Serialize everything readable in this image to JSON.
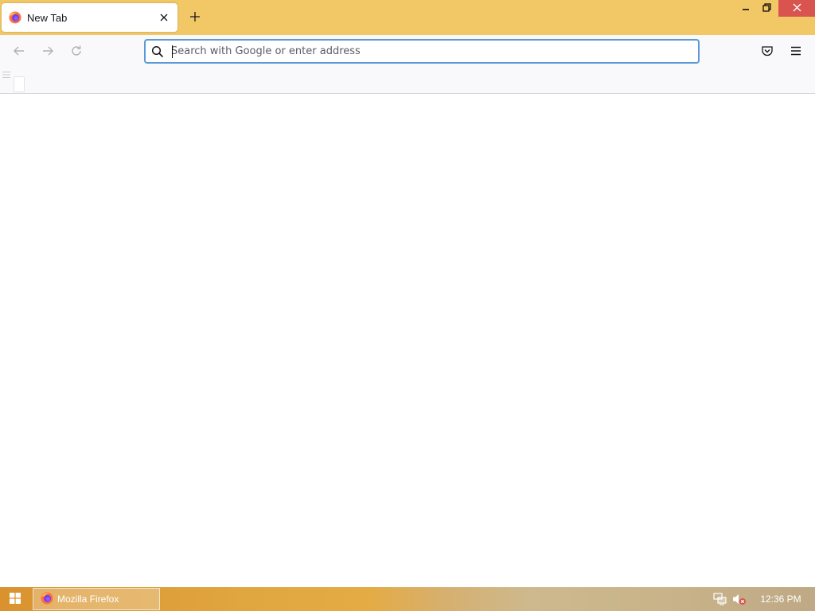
{
  "tabs": [
    {
      "title": "New Tab",
      "favicon": "firefox-icon",
      "close_icon": "close-icon"
    }
  ],
  "new_tab_icon": "plus-icon",
  "window_controls": [
    "minimize-icon",
    "restore-icon",
    "close-icon"
  ],
  "nav": {
    "back_icon": "back-arrow-icon",
    "forward_icon": "forward-arrow-icon",
    "reload_icon": "reload-icon",
    "pocket_icon": "pocket-icon",
    "menu_icon": "hamburger-menu-icon"
  },
  "urlbar": {
    "placeholder": "Search with Google or enter address",
    "value": "",
    "icon": "search-icon",
    "focus_color": "#5b9ad6"
  },
  "taskbar": {
    "start_icon": "windows-start-icon",
    "items": [
      {
        "label": "Mozilla Firefox",
        "icon": "firefox-icon"
      }
    ],
    "tray_icons": [
      "network-icon",
      "volume-muted-icon"
    ],
    "clock": "12:36 PM"
  },
  "colors": {
    "titlebar": "#f2c867",
    "toolbar": "#f9f9fb",
    "close_button": "#d9534f",
    "accent": "#5b9ad6"
  }
}
